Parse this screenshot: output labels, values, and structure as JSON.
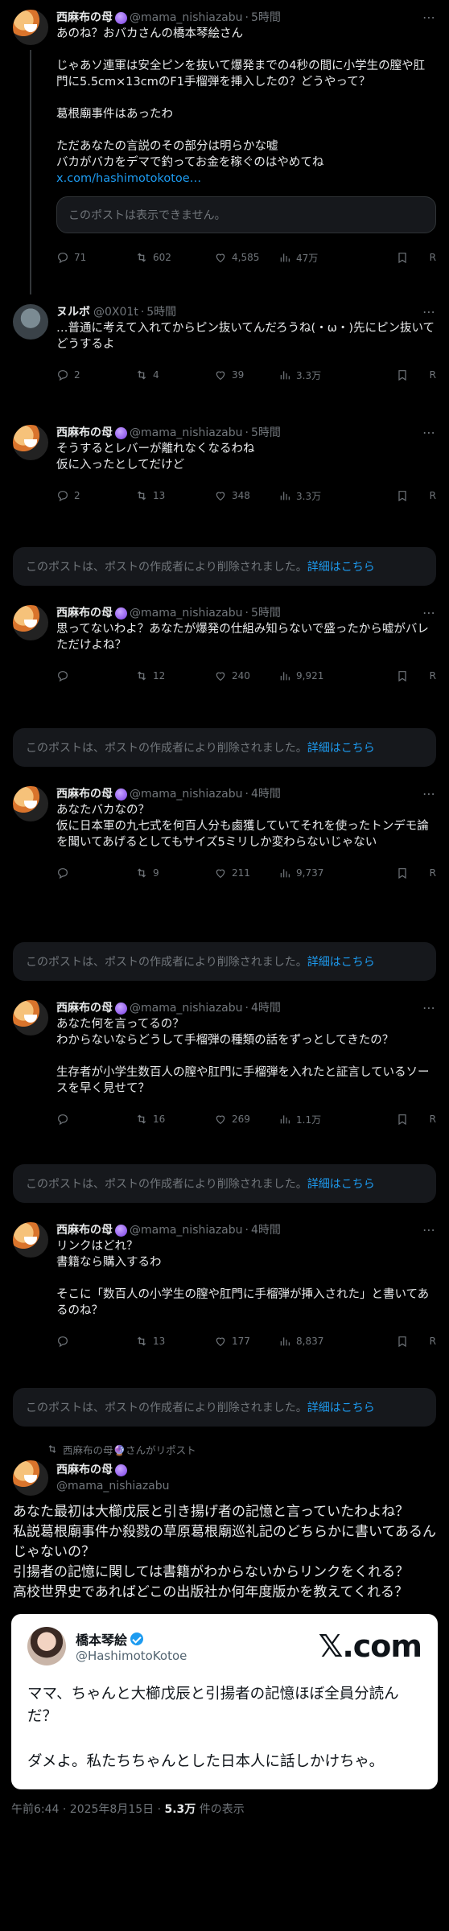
{
  "tweets": [
    {
      "name": "西麻布の母",
      "handle": "@mama_nishiazabu",
      "time": "5時間",
      "text": "あのね？おバカさんの橋本琴絵さん\n\nじゃあソ連軍は安全ピンを抜いて爆発までの4秒の間に小学生の膣や肛門に5.5cm×13cmのF1手榴弾を挿入したの？どうやって？\n\n葛根廟事件はあったわ\n\nただあなたの言説のその部分は明らかな嘘\nバカがバカをデマで釣ってお金を稼ぐのはやめてね",
      "link": "x.com/hashimotokotoe…",
      "quote_unavailable": "このポストは表示できません。",
      "replies": "71",
      "reposts": "602",
      "likes": "4,585",
      "views": "47万"
    },
    {
      "name": "ヌルボ",
      "handle": "@0X01t",
      "time": "5時間",
      "text": "…普通に考えて入れてからピン抜いてんだろうね(・ω・)先にピン抜いてどうするよ",
      "replies": "2",
      "reposts": "4",
      "likes": "39",
      "views": "3.3万"
    },
    {
      "name": "西麻布の母",
      "handle": "@mama_nishiazabu",
      "time": "5時間",
      "text": "そうするとレバーが離れなくなるわね\n仮に入ったとしてだけど",
      "replies": "2",
      "reposts": "13",
      "likes": "348",
      "views": "3.3万"
    },
    {
      "name": "西麻布の母",
      "handle": "@mama_nishiazabu",
      "time": "5時間",
      "text": "思ってないわよ？あなたが爆発の仕組み知らないで盛ったから嘘がバレただけよね？",
      "replies": "",
      "reposts": "12",
      "likes": "240",
      "views": "9,921"
    },
    {
      "name": "西麻布の母",
      "handle": "@mama_nishiazabu",
      "time": "4時間",
      "text": "あなたバカなの？\n仮に日本軍の九七式を何百人分も鹵獲していてそれを使ったトンデモ論を聞いてあげるとしてもサイズ5ミリしか変わらないじゃない",
      "replies": "",
      "reposts": "9",
      "likes": "211",
      "views": "9,737"
    },
    {
      "name": "西麻布の母",
      "handle": "@mama_nishiazabu",
      "time": "4時間",
      "text": "あなた何を言ってるの？\nわからないならどうして手榴弾の種類の話をずっとしてきたの？\n\n生存者が小学生数百人の膣や肛門に手榴弾を入れたと証言しているソースを早く見せて？",
      "replies": "",
      "reposts": "16",
      "likes": "269",
      "views": "1.1万"
    },
    {
      "name": "西麻布の母",
      "handle": "@mama_nishiazabu",
      "time": "4時間",
      "text": "リンクはどれ？\n書籍なら購入するわ\n\nそこに「数百人の小学生の膣や肛門に手榴弾が挿入された」と書いてあるのね？",
      "replies": "",
      "reposts": "13",
      "likes": "177",
      "views": "8,837"
    }
  ],
  "deleted_notice": {
    "text": "このポストは、ポストの作成者により削除されました。",
    "link": "詳細はこちら"
  },
  "repost_label": "西麻布の母🔮さんがリポスト",
  "main": {
    "name": "西麻布の母",
    "handle": "@mama_nishiazabu",
    "text": "あなた最初は大櫛戊辰と引き揚げ者の記憶と言っていたわよね？\n私説葛根廟事件か殺戮の草原葛根廟巡礼記のどちらかに書いてあるんじゃないの？\n引揚者の記憶に関しては書籍がわからないからリンクをくれる？\n高校世界史であればどこの出版社か何年度版かを教えてくれる？"
  },
  "card": {
    "name": "橋本琴絵",
    "handle": "@HashimotoKotoe",
    "brand": "𝕏.com",
    "text": "ママ、ちゃんと大櫛戊辰と引揚者の記憶ほぼ全員分読んだ？\n\nダメよ。私たちちゃんとした日本人に話しかけちゃ。"
  },
  "footer": {
    "timestamp": "午前6:44 · 2025年8月15日 · ",
    "views": "5.3万",
    "views_suffix": " 件の表示"
  },
  "more_icon": "⋯",
  "share_letter": "R"
}
